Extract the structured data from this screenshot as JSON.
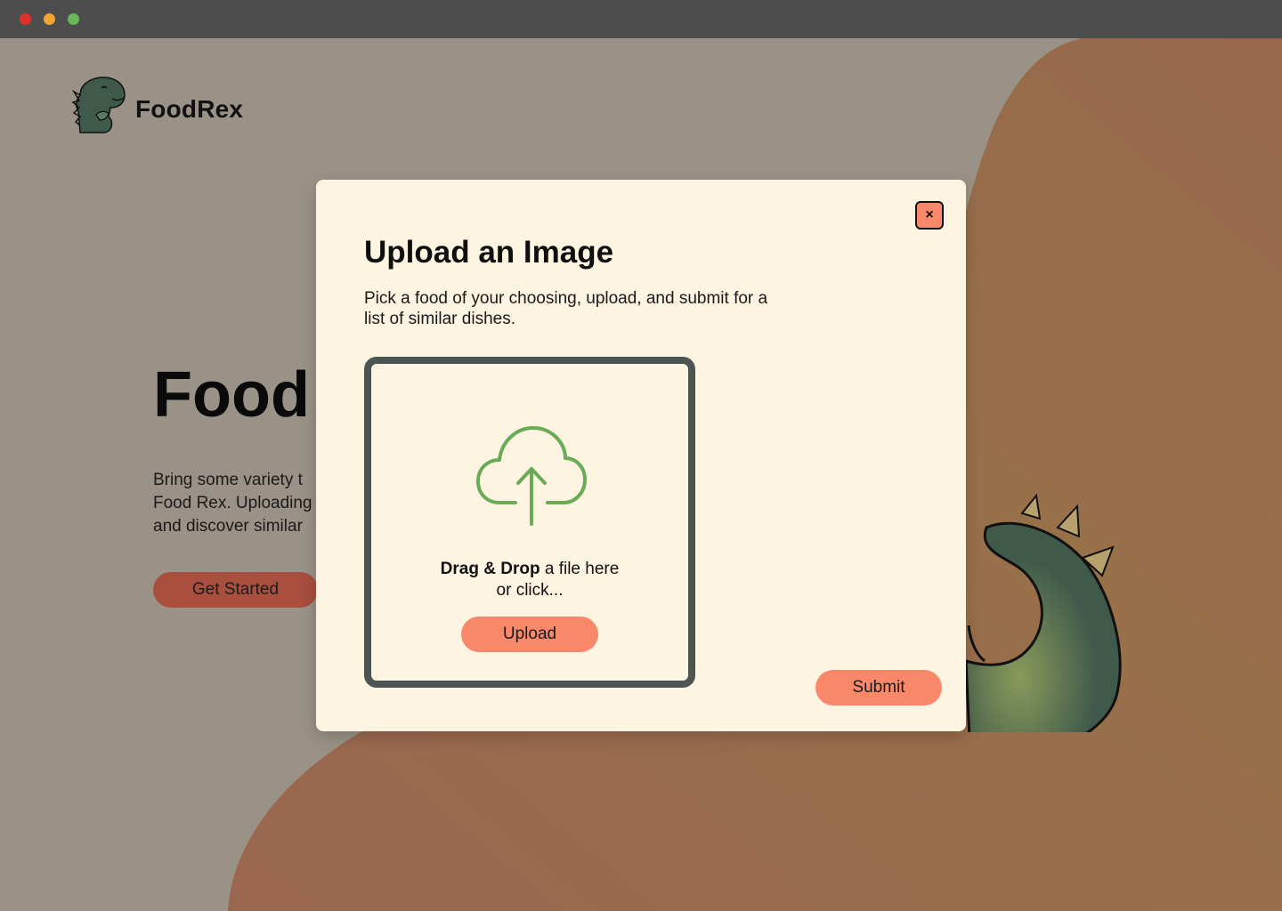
{
  "window": {
    "controls": [
      "close",
      "minimize",
      "maximize"
    ]
  },
  "header": {
    "brand": "FoodRex",
    "logo_icon": "dinosaur-icon"
  },
  "hero": {
    "title": "Food",
    "text_lines": [
      "Bring some variety t",
      "Food Rex. Uploading",
      "and discover similar"
    ],
    "cta_label": "Get Started"
  },
  "modal": {
    "title": "Upload an Image",
    "description": "Pick a food of your choosing, upload, and submit for a list of similar dishes.",
    "close_label": "×",
    "dropzone": {
      "icon": "cloud-upload-icon",
      "bold_text": "Drag & Drop",
      "rest_text": " a file here",
      "line2": "or click...",
      "upload_label": "Upload"
    },
    "submit_label": "Submit"
  },
  "colors": {
    "background": "#9a9286",
    "blob": "#9a6a4c",
    "modal_bg": "#fef4e2",
    "accent": "#f9876a",
    "dark_border": "#4b5553",
    "cloud_green": "#6aab55",
    "dino_green": "#3f5a4b",
    "hero_button": "#a84f3e"
  }
}
